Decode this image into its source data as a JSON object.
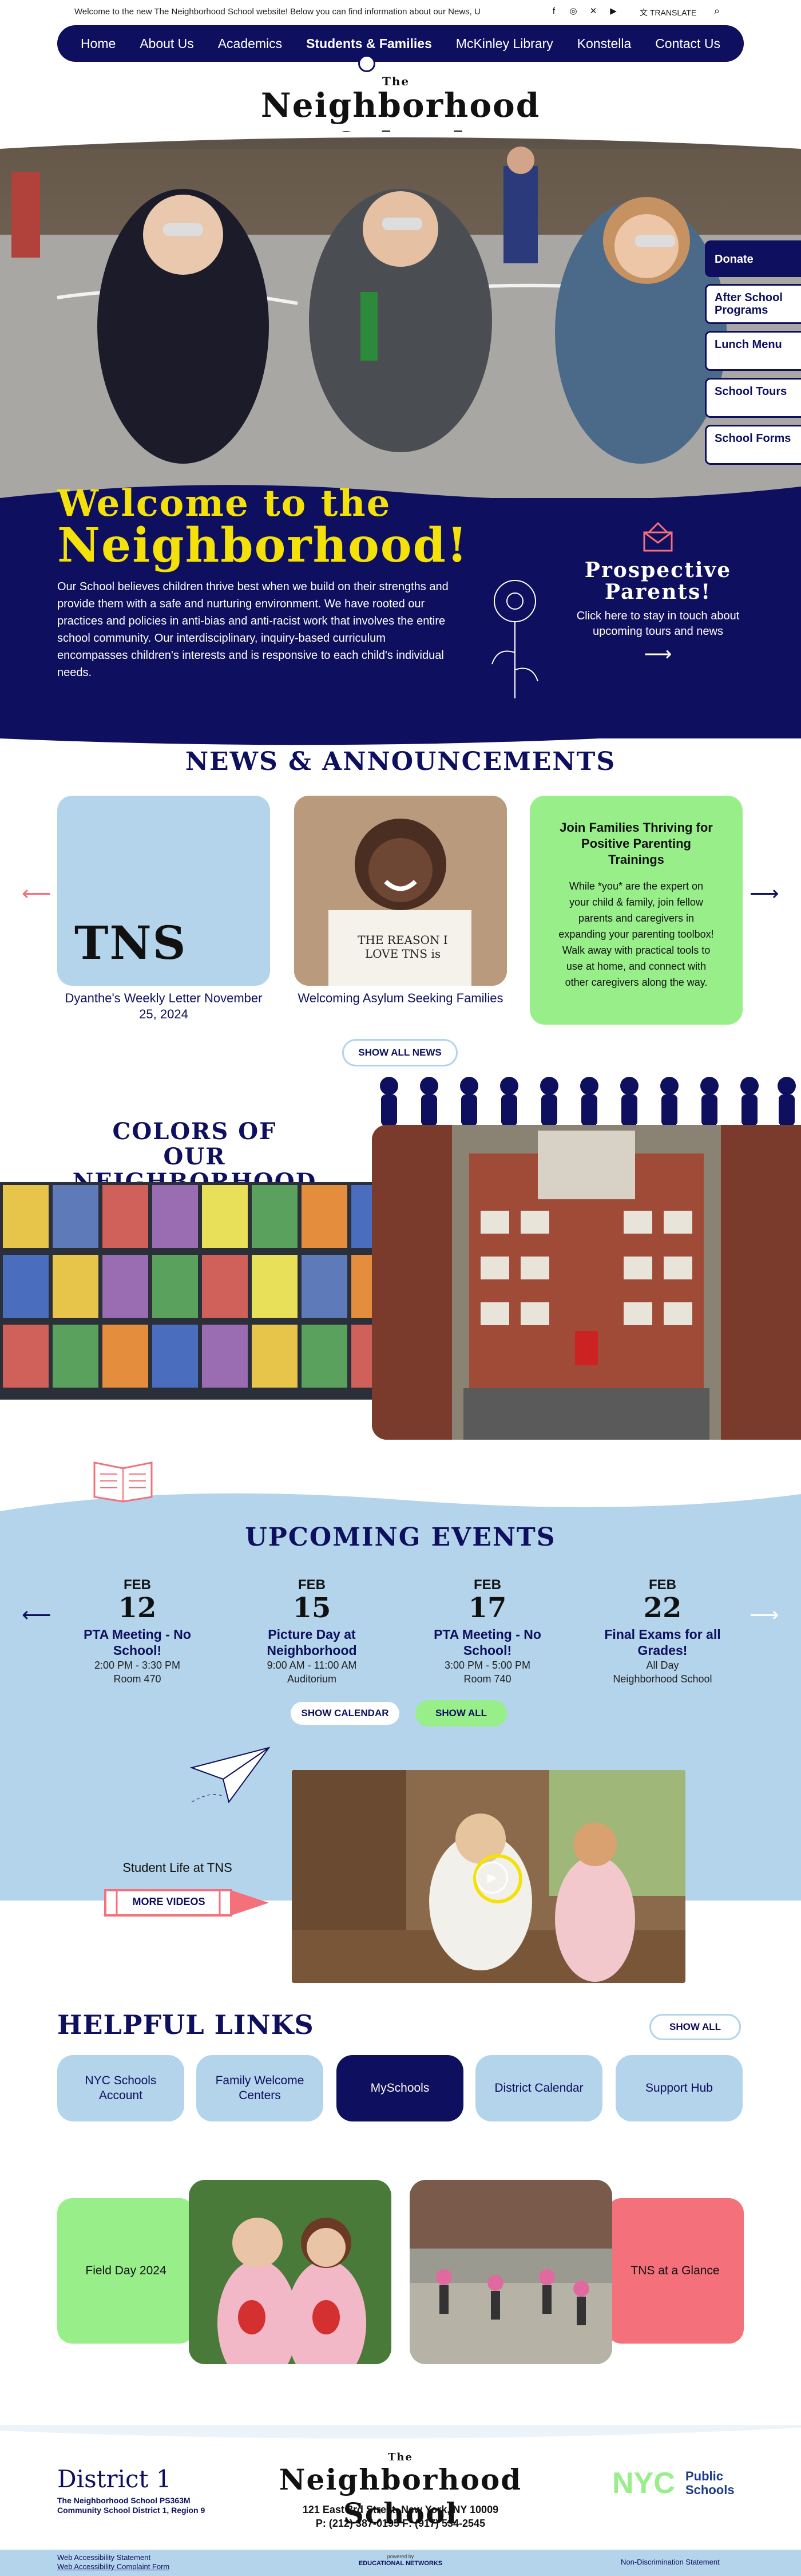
{
  "topbar": {
    "ticker": "Welcome to the new The Neighborhood School website! Below you can find information about our News, U",
    "translate": "TRANSLATE"
  },
  "nav": {
    "items": [
      "Home",
      "About Us",
      "Academics",
      "Students & Families",
      "McKinley Library",
      "Konstella",
      "Contact Us"
    ]
  },
  "logo": {
    "the": "The",
    "name": "Neighborhood School"
  },
  "hero": {
    "donate": "Donate",
    "links": [
      "After School Programs",
      "Lunch Menu",
      "School Tours",
      "School Forms"
    ]
  },
  "welcome": {
    "title_line1": "Welcome to the",
    "title_line2": "Neighborhood!",
    "body": "Our School believes children thrive best when we build on their strengths and provide them with a safe and nurturing environment. We have rooted our practices and policies in anti-bias and anti-racist work that involves the entire school community. Our interdisciplinary, inquiry-based curriculum encompasses children's interests and is responsive to each child's individual needs.",
    "prospective_title": "Prospective Parents!",
    "prospective_body": "Click here to stay in touch about upcoming tours and news"
  },
  "news": {
    "heading": "NEWS & ANNOUNCEMENTS",
    "cards": [
      {
        "title": "Dyanthe's Weekly Letter November 25, 2024",
        "img_text": "TNS"
      },
      {
        "title": "Welcoming Asylum Seeking Families",
        "img_text": "THE REASON I LOVE TNS is"
      },
      {
        "title": "Join Families Thriving for Positive Parenting Trainings",
        "body": "While *you* are the expert on your child & family, join fellow parents and caregivers in expanding your parenting toolbox! Walk away with practical tools to use at home, and connect with other caregivers along the way."
      }
    ],
    "show_all": "SHOW ALL NEWS"
  },
  "colors": {
    "heading_line1": "COLORS OF",
    "heading_line2": "OUR NEIGHBORHOOD"
  },
  "events": {
    "heading": "UPCOMING EVENTS",
    "items": [
      {
        "month": "FEB",
        "day": "12",
        "title": "PTA Meeting - No School!",
        "time": "2:00 PM - 3:30 PM",
        "place": "Room 470"
      },
      {
        "month": "FEB",
        "day": "15",
        "title": "Picture Day at Neighborhood",
        "time": "9:00 AM - 11:00 AM",
        "place": "Auditorium"
      },
      {
        "month": "FEB",
        "day": "17",
        "title": "PTA Meeting - No School!",
        "time": "3:00 PM - 5:00 PM",
        "place": "Room 740"
      },
      {
        "month": "FEB",
        "day": "22",
        "title": "Final Exams for all Grades!",
        "time": "All Day",
        "place": "Neighborhood School"
      }
    ],
    "show_calendar": "SHOW CALENDAR",
    "show_all": "SHOW ALL"
  },
  "video": {
    "label": "Student Life at TNS",
    "button": "MORE VIDEOS"
  },
  "helpful": {
    "heading": "HELPFUL LINKS",
    "show_all": "SHOW ALL",
    "links": [
      "NYC Schools Account",
      "Family Welcome Centers",
      "MySchools",
      "District Calendar",
      "Support Hub"
    ]
  },
  "gallery": {
    "field_day": "Field Day 2024",
    "glance": "TNS at a Glance"
  },
  "footer": {
    "district": "District 1",
    "school_line1": "The Neighborhood School PS363M",
    "school_line2": "Community School District 1, Region 9",
    "address": "121 East 3rd Street, New York, NY 10009",
    "phone": "P: (212) 387-0195   F: (917) 534-2545",
    "nyc": "NYC",
    "public_schools_1": "Public",
    "public_schools_2": "Schools",
    "powered_by": "powered by",
    "provider": "EDUCATIONAL NETWORKS",
    "accessibility_statement": "Web Accessibility Statement",
    "accessibility_complaint": "Web Accessibility Complaint Form",
    "non_discrimination": "Non-Discrimination Statement"
  },
  "colors_brand": {
    "navy": "#0e0f5e",
    "light_blue": "#b3d4ea",
    "yellow": "#f4e10a",
    "green": "#98ef8a",
    "coral": "#f4707a"
  }
}
